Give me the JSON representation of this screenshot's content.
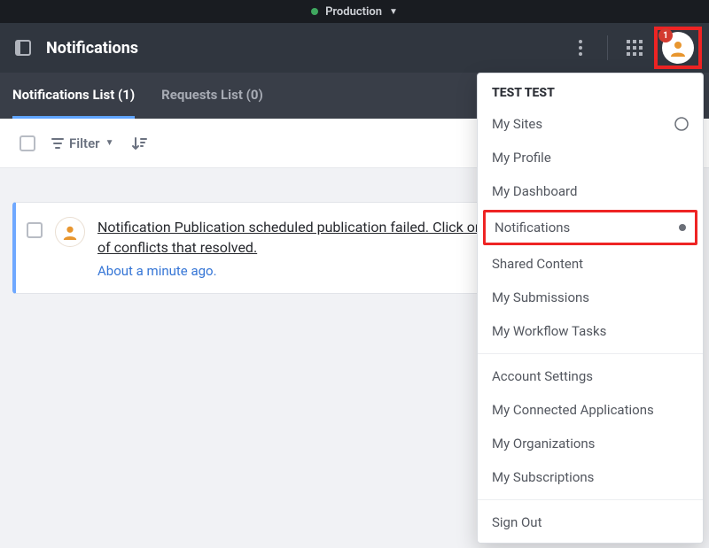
{
  "env": {
    "label": "Production"
  },
  "header": {
    "title": "Notifications",
    "avatar_badge": "1"
  },
  "tabs": [
    {
      "label": "Notifications List (1)",
      "active": true
    },
    {
      "label": "Requests List (0)",
      "active": false
    }
  ],
  "toolbar": {
    "filter_label": "Filter"
  },
  "notifications": [
    {
      "text": "Notification Publication scheduled publication failed. Click on this notification to see the list of conflicts that resolved.",
      "time": "About a minute ago."
    }
  ],
  "user_menu": {
    "username": "TEST TEST",
    "sections": [
      [
        {
          "label": "My Sites",
          "icon": "compass"
        },
        {
          "label": "My Profile"
        },
        {
          "label": "My Dashboard"
        },
        {
          "label": "Notifications",
          "highlight": true,
          "dot": true
        },
        {
          "label": "Shared Content"
        },
        {
          "label": "My Submissions"
        },
        {
          "label": "My Workflow Tasks"
        }
      ],
      [
        {
          "label": "Account Settings"
        },
        {
          "label": "My Connected Applications"
        },
        {
          "label": "My Organizations"
        },
        {
          "label": "My Subscriptions"
        }
      ],
      [
        {
          "label": "Sign Out"
        }
      ]
    ]
  }
}
